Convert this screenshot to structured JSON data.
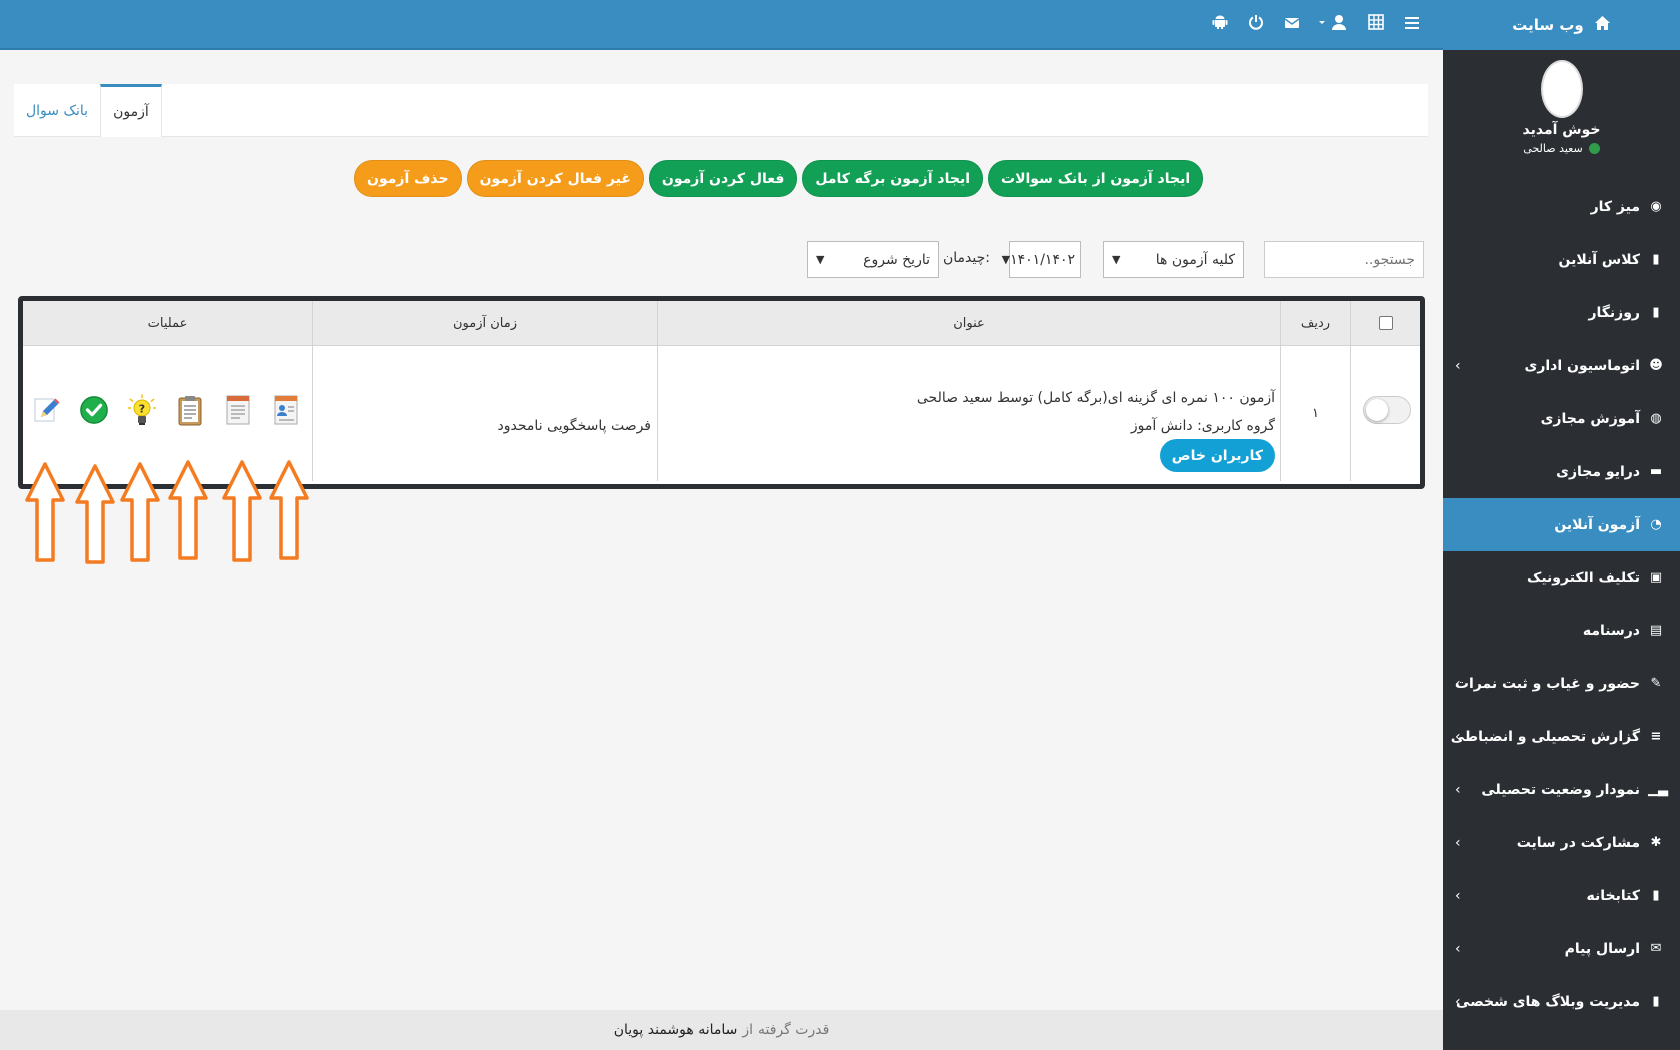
{
  "sidebar": {
    "site_label": "وب سایت",
    "welcome": "خوش آمدید",
    "user_name": "سعید صالحی",
    "items": [
      {
        "label": "میز کار",
        "icon": "dashboard-icon",
        "has_children": false,
        "active": false
      },
      {
        "label": "کلاس آنلاین",
        "icon": "book-icon",
        "has_children": false,
        "active": false
      },
      {
        "label": "روزنگار",
        "icon": "book-icon",
        "has_children": false,
        "active": false
      },
      {
        "label": "اتوماسیون اداری",
        "icon": "users-icon",
        "has_children": true,
        "active": false
      },
      {
        "label": "آموزش مجازی",
        "icon": "globe-icon",
        "has_children": false,
        "active": false
      },
      {
        "label": "درایو مجازی",
        "icon": "folder-icon",
        "has_children": false,
        "active": false
      },
      {
        "label": "آزمون آنلاین",
        "icon": "clock-icon",
        "has_children": false,
        "active": true
      },
      {
        "label": "تکلیف الکترونیک",
        "icon": "briefcase-icon",
        "has_children": false,
        "active": false
      },
      {
        "label": "درسنامه",
        "icon": "document-icon",
        "has_children": false,
        "active": false
      },
      {
        "label": "حضور و غیاب و ثبت نمرات",
        "icon": "edit-icon",
        "has_children": true,
        "active": false
      },
      {
        "label": "گزارش تحصیلی و انضباطی",
        "icon": "list-icon",
        "has_children": true,
        "active": false
      },
      {
        "label": "نمودار وضعیت تحصیلی",
        "icon": "bar-chart-icon",
        "has_children": true,
        "active": false
      },
      {
        "label": "مشارکت در سایت",
        "icon": "asterisk-icon",
        "has_children": true,
        "active": false
      },
      {
        "label": "کتابخانه",
        "icon": "book-icon",
        "has_children": true,
        "active": false
      },
      {
        "label": "ارسال پیام",
        "icon": "envelope-icon",
        "has_children": true,
        "active": false
      },
      {
        "label": "مدیریت وبلاگ های شخصی",
        "icon": "book-icon",
        "has_children": true,
        "active": false
      }
    ]
  },
  "topbar": {
    "icons": [
      "android-icon",
      "power-icon",
      "envelope-icon",
      "user-icon",
      "grid-icon",
      "menu-icon"
    ]
  },
  "tabs": [
    {
      "label": "آزمون",
      "active": true
    },
    {
      "label": "بانک سوال",
      "active": false
    }
  ],
  "actions": [
    {
      "label": "ایجاد آزمون از بانک سوالات",
      "color": "#12a056"
    },
    {
      "label": "ایجاد آزمون برگه کامل",
      "color": "#12a056"
    },
    {
      "label": "فعال کردن آزمون",
      "color": "#12a056"
    },
    {
      "label": "غیر فعال کردن آزمون",
      "color": "#f59c1a"
    },
    {
      "label": "حذف آزمون",
      "color": "#f59c1a"
    }
  ],
  "filters": {
    "search_placeholder": "جستجو..",
    "exam_filter": "کلیه آزمون ها",
    "year": "۱۴۰۱/۱۴۰۲",
    "sort_label": "چیدمان:",
    "sort_value": "تاریخ شروع"
  },
  "table": {
    "headers": {
      "row": "ردیف",
      "title": "عنوان",
      "time": "زمان آزمون",
      "ops": "عملیات"
    },
    "rows": [
      {
        "row": "۱",
        "title_line1": "آزمون ۱۰۰ نمره ای گزینه ای(برگه کامل) توسط سعید صالحی",
        "title_line2": "گروه کاربری: دانش آموز",
        "badge": "کاربران خاص",
        "time": "فرصت پاسخگویی نامحدود",
        "active": false
      }
    ],
    "op_icons": [
      "edit-pencil-icon",
      "check-icon",
      "lightbulb-icon",
      "clipboard-icon",
      "report-icon",
      "user-card-icon"
    ]
  },
  "footer": {
    "prefix": "قدرت گرفته",
    "from": "از",
    "brand": "سامانه هوشمند پویان"
  }
}
